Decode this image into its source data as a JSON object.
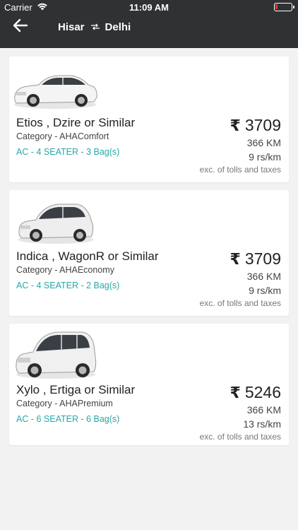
{
  "status_bar": {
    "carrier": "Carrier",
    "time": "11:09 AM",
    "battery_color": "#e53935"
  },
  "header": {
    "back_icon": "arrow-left-icon",
    "from": "Hisar",
    "to": "Delhi",
    "swap_icon": "swap-arrows-icon"
  },
  "currency_symbol": "₹",
  "cars": [
    {
      "name": "Etios , Dzire or Similar",
      "category": "Category - AHAComfort",
      "features": "AC - 4 SEATER - 3 Bag(s)",
      "price": "3709",
      "distance": "366 KM",
      "rate": "9 rs/km",
      "note": "exc. of tolls and taxes",
      "image_icon": "sedan-car-image"
    },
    {
      "name": "Indica , WagonR or Similar",
      "category": "Category - AHAEconomy",
      "features": "AC - 4 SEATER - 2 Bag(s)",
      "price": "3709",
      "distance": "366 KM",
      "rate": "9 rs/km",
      "note": "exc. of tolls and taxes",
      "image_icon": "hatchback-car-image"
    },
    {
      "name": "Xylo , Ertiga or Similar",
      "category": "Category - AHAPremium",
      "features": "AC - 6 SEATER - 6 Bag(s)",
      "price": "5246",
      "distance": "366 KM",
      "rate": "13 rs/km",
      "note": "exc. of tolls and taxes",
      "image_icon": "mpv-car-image"
    }
  ],
  "colors": {
    "header_bg": "#2f3133",
    "page_bg": "#f2f2f2",
    "feature_text": "#27a7a8"
  }
}
